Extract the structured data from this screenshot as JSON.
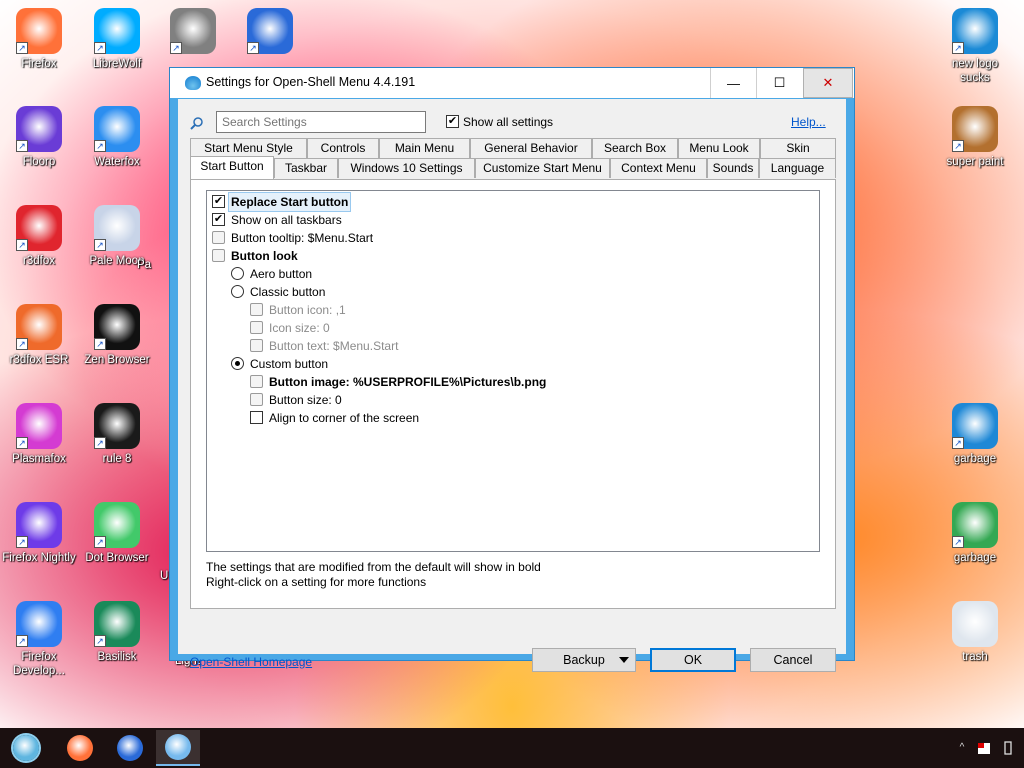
{
  "desktop": {
    "left_icons": [
      {
        "label": "Firefox",
        "icon": "firefox-icon",
        "color": "#ff7139"
      },
      {
        "label": "LibreWolf",
        "icon": "librewolf-icon",
        "color": "#00acff"
      },
      {
        "label": "",
        "icon": "waterfox-raccoon-icon",
        "color": "#808080"
      },
      {
        "label": "",
        "icon": "globe-browser-icon",
        "color": "#2a6ad8"
      },
      {
        "label": "Floorp",
        "icon": "floorp-icon",
        "color": "#6a3cd6"
      },
      {
        "label": "Waterfox",
        "icon": "waterfox-icon",
        "color": "#2c8ef0"
      },
      {
        "label": "r3dfox",
        "icon": "r3dfox-icon",
        "color": "#e0252e"
      },
      {
        "label": "Pale Moon",
        "icon": "pale-moon-icon",
        "color": "#c8d4e8"
      },
      {
        "label": "r3dfox ESR",
        "icon": "r3dfox-esr-icon",
        "color": "#ef6a2b"
      },
      {
        "label": "Zen Browser",
        "icon": "zen-browser-icon",
        "color": "#111111"
      },
      {
        "label": "Plasmafox",
        "icon": "plasmafox-icon",
        "color": "#d43bd2"
      },
      {
        "label": "rule 8",
        "icon": "rule8-icon",
        "color": "#1a1a1a"
      },
      {
        "label": "Firefox Nightly",
        "icon": "firefox-nightly-icon",
        "color": "#6e3be8"
      },
      {
        "label": "Dot Browser",
        "icon": "dot-browser-icon",
        "color": "#42c96a"
      },
      {
        "label": "Firefox Develop...",
        "icon": "firefox-developer-icon",
        "color": "#2f7ef1"
      },
      {
        "label": "Basilisk",
        "icon": "basilisk-icon",
        "color": "#1a8a5a"
      }
    ],
    "right_icons": [
      {
        "label": "new logo sucks",
        "icon": "vs-logo-icon",
        "color": "#1b8ad6"
      },
      {
        "label": "super paint",
        "icon": "paint-palette-icon",
        "color": "#b3702f"
      },
      {
        "label": "garbage",
        "icon": "edge-icon",
        "color": "#1e88d6"
      },
      {
        "label": "garbage",
        "icon": "chrome-icon",
        "color": "#34a853"
      },
      {
        "label": "trash",
        "icon": "recycle-bin-icon",
        "color": "#dfe6ee"
      }
    ],
    "partial_labels": [
      "Pa",
      "U",
      "Light"
    ]
  },
  "window": {
    "title": "Settings for Open-Shell Menu 4.4.191",
    "minimize_glyph": "—",
    "maximize_glyph": "☐",
    "close_glyph": "✕",
    "search_placeholder": "Search Settings",
    "show_all_label": "Show all settings",
    "show_all_checked": true,
    "help_label": "Help...",
    "tabs_row1": [
      "Start Menu Style",
      "Controls",
      "Main Menu",
      "General Behavior",
      "Search Box",
      "Menu Look",
      "Skin"
    ],
    "tabs_row2": [
      "Start Button",
      "Taskbar",
      "Windows 10 Settings",
      "Customize Start Menu",
      "Context Menu",
      "Sounds",
      "Language"
    ],
    "active_tab": "Start Button",
    "settings": [
      {
        "label": "Replace Start button",
        "control": "checkbox",
        "checked": true,
        "bold": true,
        "dim": false,
        "indent": 0,
        "selected": true
      },
      {
        "label": "Show on all taskbars",
        "control": "checkbox",
        "checked": true,
        "bold": false,
        "dim": false,
        "indent": 0,
        "selected": false
      },
      {
        "label": "Button tooltip: $Menu.Start",
        "control": "gear",
        "checked": false,
        "bold": false,
        "dim": false,
        "indent": 0,
        "selected": false
      },
      {
        "label": "Button look",
        "control": "gear",
        "checked": false,
        "bold": true,
        "dim": false,
        "indent": 0,
        "selected": false
      },
      {
        "label": "Aero button",
        "control": "radio",
        "checked": false,
        "bold": false,
        "dim": false,
        "indent": 1,
        "selected": false
      },
      {
        "label": "Classic button",
        "control": "radio",
        "checked": false,
        "bold": false,
        "dim": false,
        "indent": 1,
        "selected": false
      },
      {
        "label": "Button icon: ,1",
        "control": "gear",
        "checked": false,
        "bold": false,
        "dim": true,
        "indent": 2,
        "selected": false
      },
      {
        "label": "Icon size: 0",
        "control": "gear",
        "checked": false,
        "bold": false,
        "dim": true,
        "indent": 2,
        "selected": false
      },
      {
        "label": "Button text: $Menu.Start",
        "control": "gear",
        "checked": false,
        "bold": false,
        "dim": true,
        "indent": 2,
        "selected": false
      },
      {
        "label": "Custom button",
        "control": "radio",
        "checked": true,
        "bold": false,
        "dim": false,
        "indent": 1,
        "selected": false
      },
      {
        "label": "Button image: %USERPROFILE%\\Pictures\\b.png",
        "control": "gear",
        "checked": false,
        "bold": true,
        "dim": false,
        "indent": 2,
        "selected": false
      },
      {
        "label": "Button size: 0",
        "control": "gear",
        "checked": false,
        "bold": false,
        "dim": false,
        "indent": 2,
        "selected": false
      },
      {
        "label": "Align to corner of the screen",
        "control": "checkbox",
        "checked": false,
        "bold": false,
        "dim": false,
        "indent": 2,
        "selected": false
      }
    ],
    "note_line1": "The settings that are modified from the default will show in bold",
    "note_line2": "Right-click on a setting for more functions",
    "homepage_label": "Open-Shell Homepage",
    "backup_label": "Backup",
    "ok_label": "OK",
    "cancel_label": "Cancel"
  },
  "taskbar": {
    "items": [
      {
        "icon": "start-button-icon",
        "color": "#5fb6e0"
      },
      {
        "icon": "firefox-taskbar-icon",
        "color": "#ff7139"
      },
      {
        "icon": "waterfox-taskbar-icon",
        "color": "#2a6ad8"
      },
      {
        "icon": "open-shell-settings-taskbar-icon",
        "color": "#76b9ed"
      }
    ],
    "tray_up_glyph": "^"
  }
}
